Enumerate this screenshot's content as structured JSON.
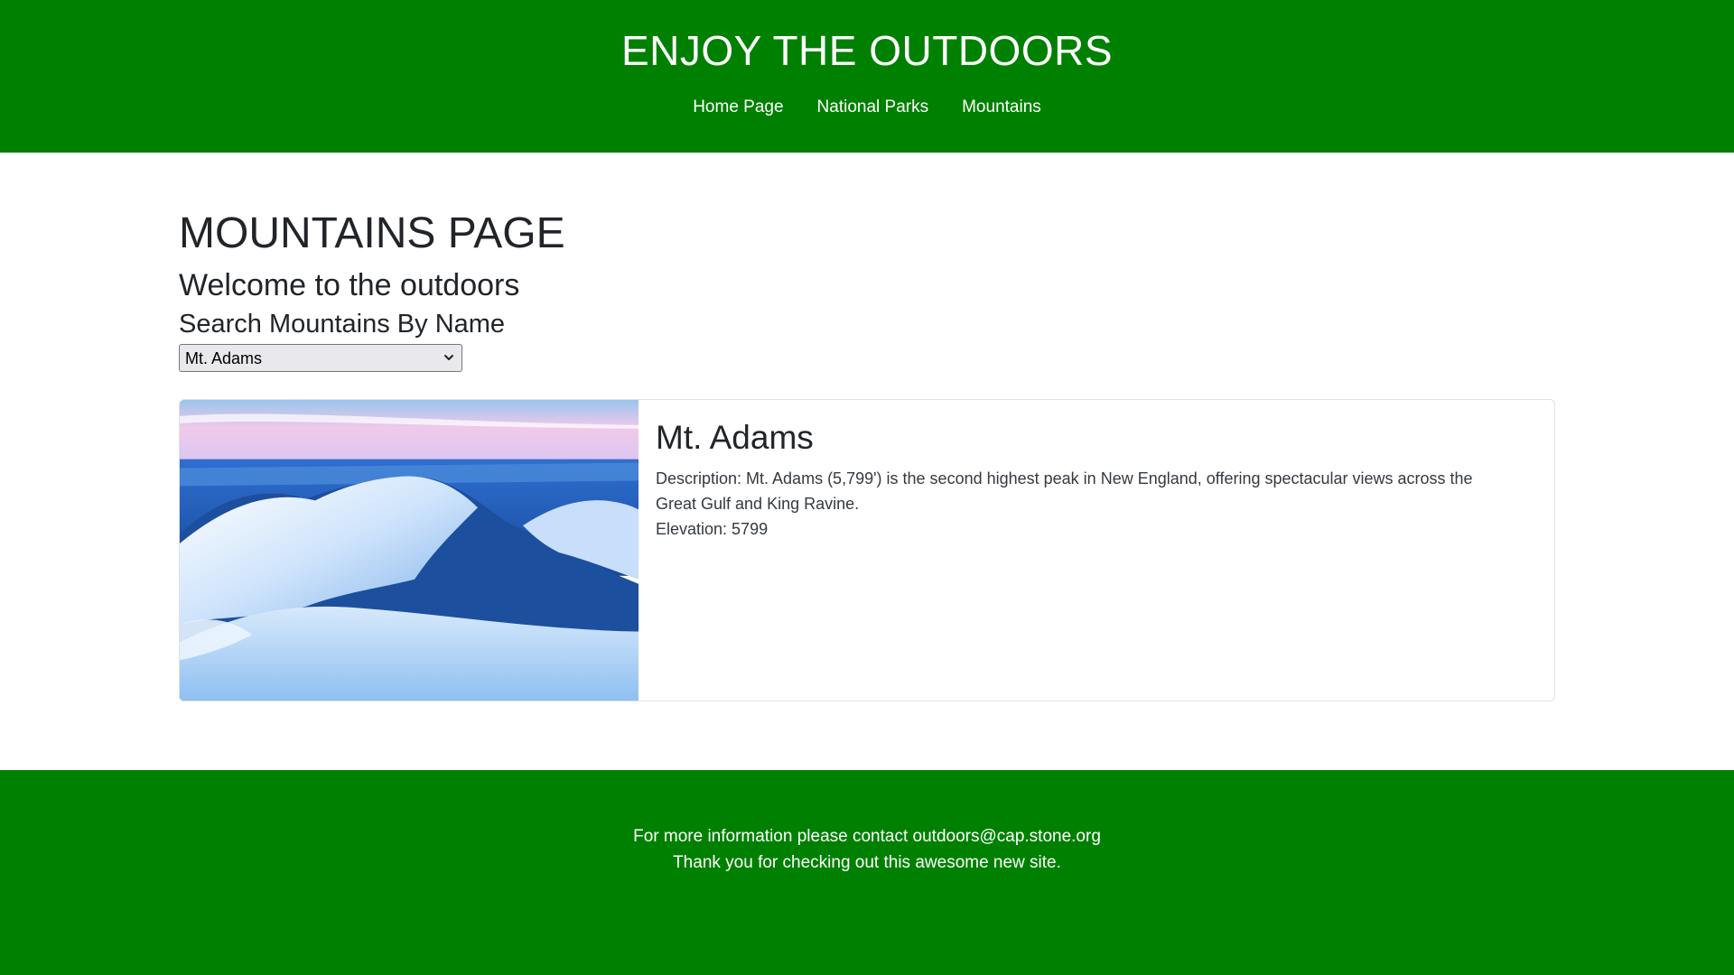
{
  "header": {
    "title": "ENJOY THE OUTDOORS",
    "nav": [
      "Home Page",
      "National Parks",
      "Mountains"
    ]
  },
  "main": {
    "title": "MOUNTAINS PAGE",
    "subtitle": "Welcome to the outdoors",
    "search_label": "Search Mountains By Name",
    "select": {
      "selected": "Mt. Adams",
      "icon": "chevron-down-icon"
    }
  },
  "card": {
    "title": "Mt. Adams",
    "description": "Description: Mt. Adams (5,799') is the second highest peak in New England, offering spectacular views across the Great Gulf and King Ravine.",
    "elevation": "Elevation: 5799"
  },
  "footer": {
    "line1": "For more information please contact outdoors@cap.stone.org",
    "line2": "Thank you for checking out this awesome new site."
  },
  "colors": {
    "brand_green": "#008000",
    "text": "#212529"
  }
}
